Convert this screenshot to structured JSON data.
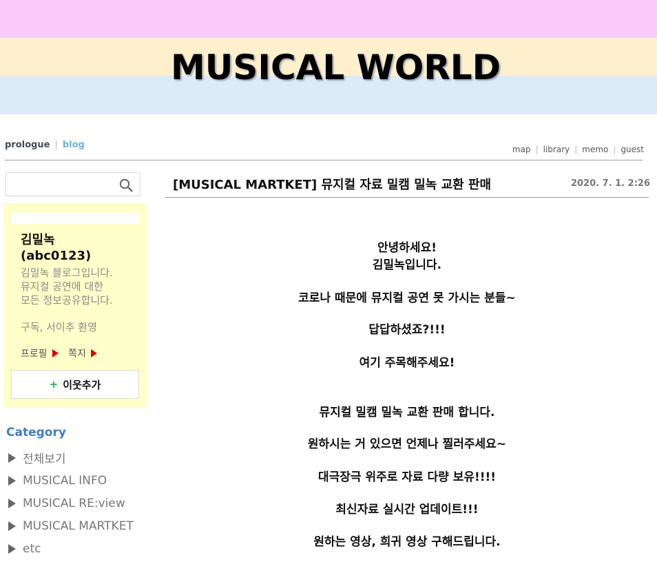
{
  "banner": {
    "title": "MUSICAL WORLD",
    "colors": {
      "band1": "#fccbfb",
      "band2": "#fef0cc",
      "band3": "#ddeaf7"
    }
  },
  "nav": {
    "left": {
      "prologue": "prologue",
      "blog": "blog"
    },
    "right": [
      "map",
      "library",
      "memo",
      "guest"
    ]
  },
  "search": {
    "placeholder": "",
    "icon": "search-icon"
  },
  "profile": {
    "name": "김밀녹",
    "id": "(abc0123)",
    "desc_lines": [
      "김밀녹 블로그입니다.",
      "뮤지컬 공연에 대한",
      "모든 정보공유합니다."
    ],
    "welcome": "구독, 서이추 환영",
    "profile_link": "프로필",
    "message_link": "쪽지",
    "add_friend_plus": "+",
    "add_friend_label": "이웃추가"
  },
  "category": {
    "title": "Category",
    "items": [
      "전체보기",
      "MUSICAL INFO",
      "MUSICAL RE:view",
      "MUSICAL MARTKET",
      "etc"
    ]
  },
  "post": {
    "title": "[MUSICAL MARTKET] 뮤지컬 자료 밀캠 밀녹 교환 판매",
    "date": "2020. 7. 1. 2:26",
    "lines": [
      "안녕하세요!",
      "김밀녹입니다.",
      "코로나 때문에 뮤지컬 공연 못 가시는 분들~",
      "답답하셨죠?!!!",
      "여기 주목해주세요!",
      "뮤지컬 밀캠 밀녹 교환 판매 합니다.",
      "원하시는 거 있으면 언제나 찔러주세요~",
      "대극장극 위주로 자료 다량 보유!!!!",
      "최신자료 실시간 업데이트!!!",
      "원하는 영상, 희귀 영상 구해드립니다."
    ]
  },
  "colors": {
    "accent_blue": "#3f7fc2",
    "profile_bg": "#ffffc9",
    "red_arrow": "#e00000"
  }
}
